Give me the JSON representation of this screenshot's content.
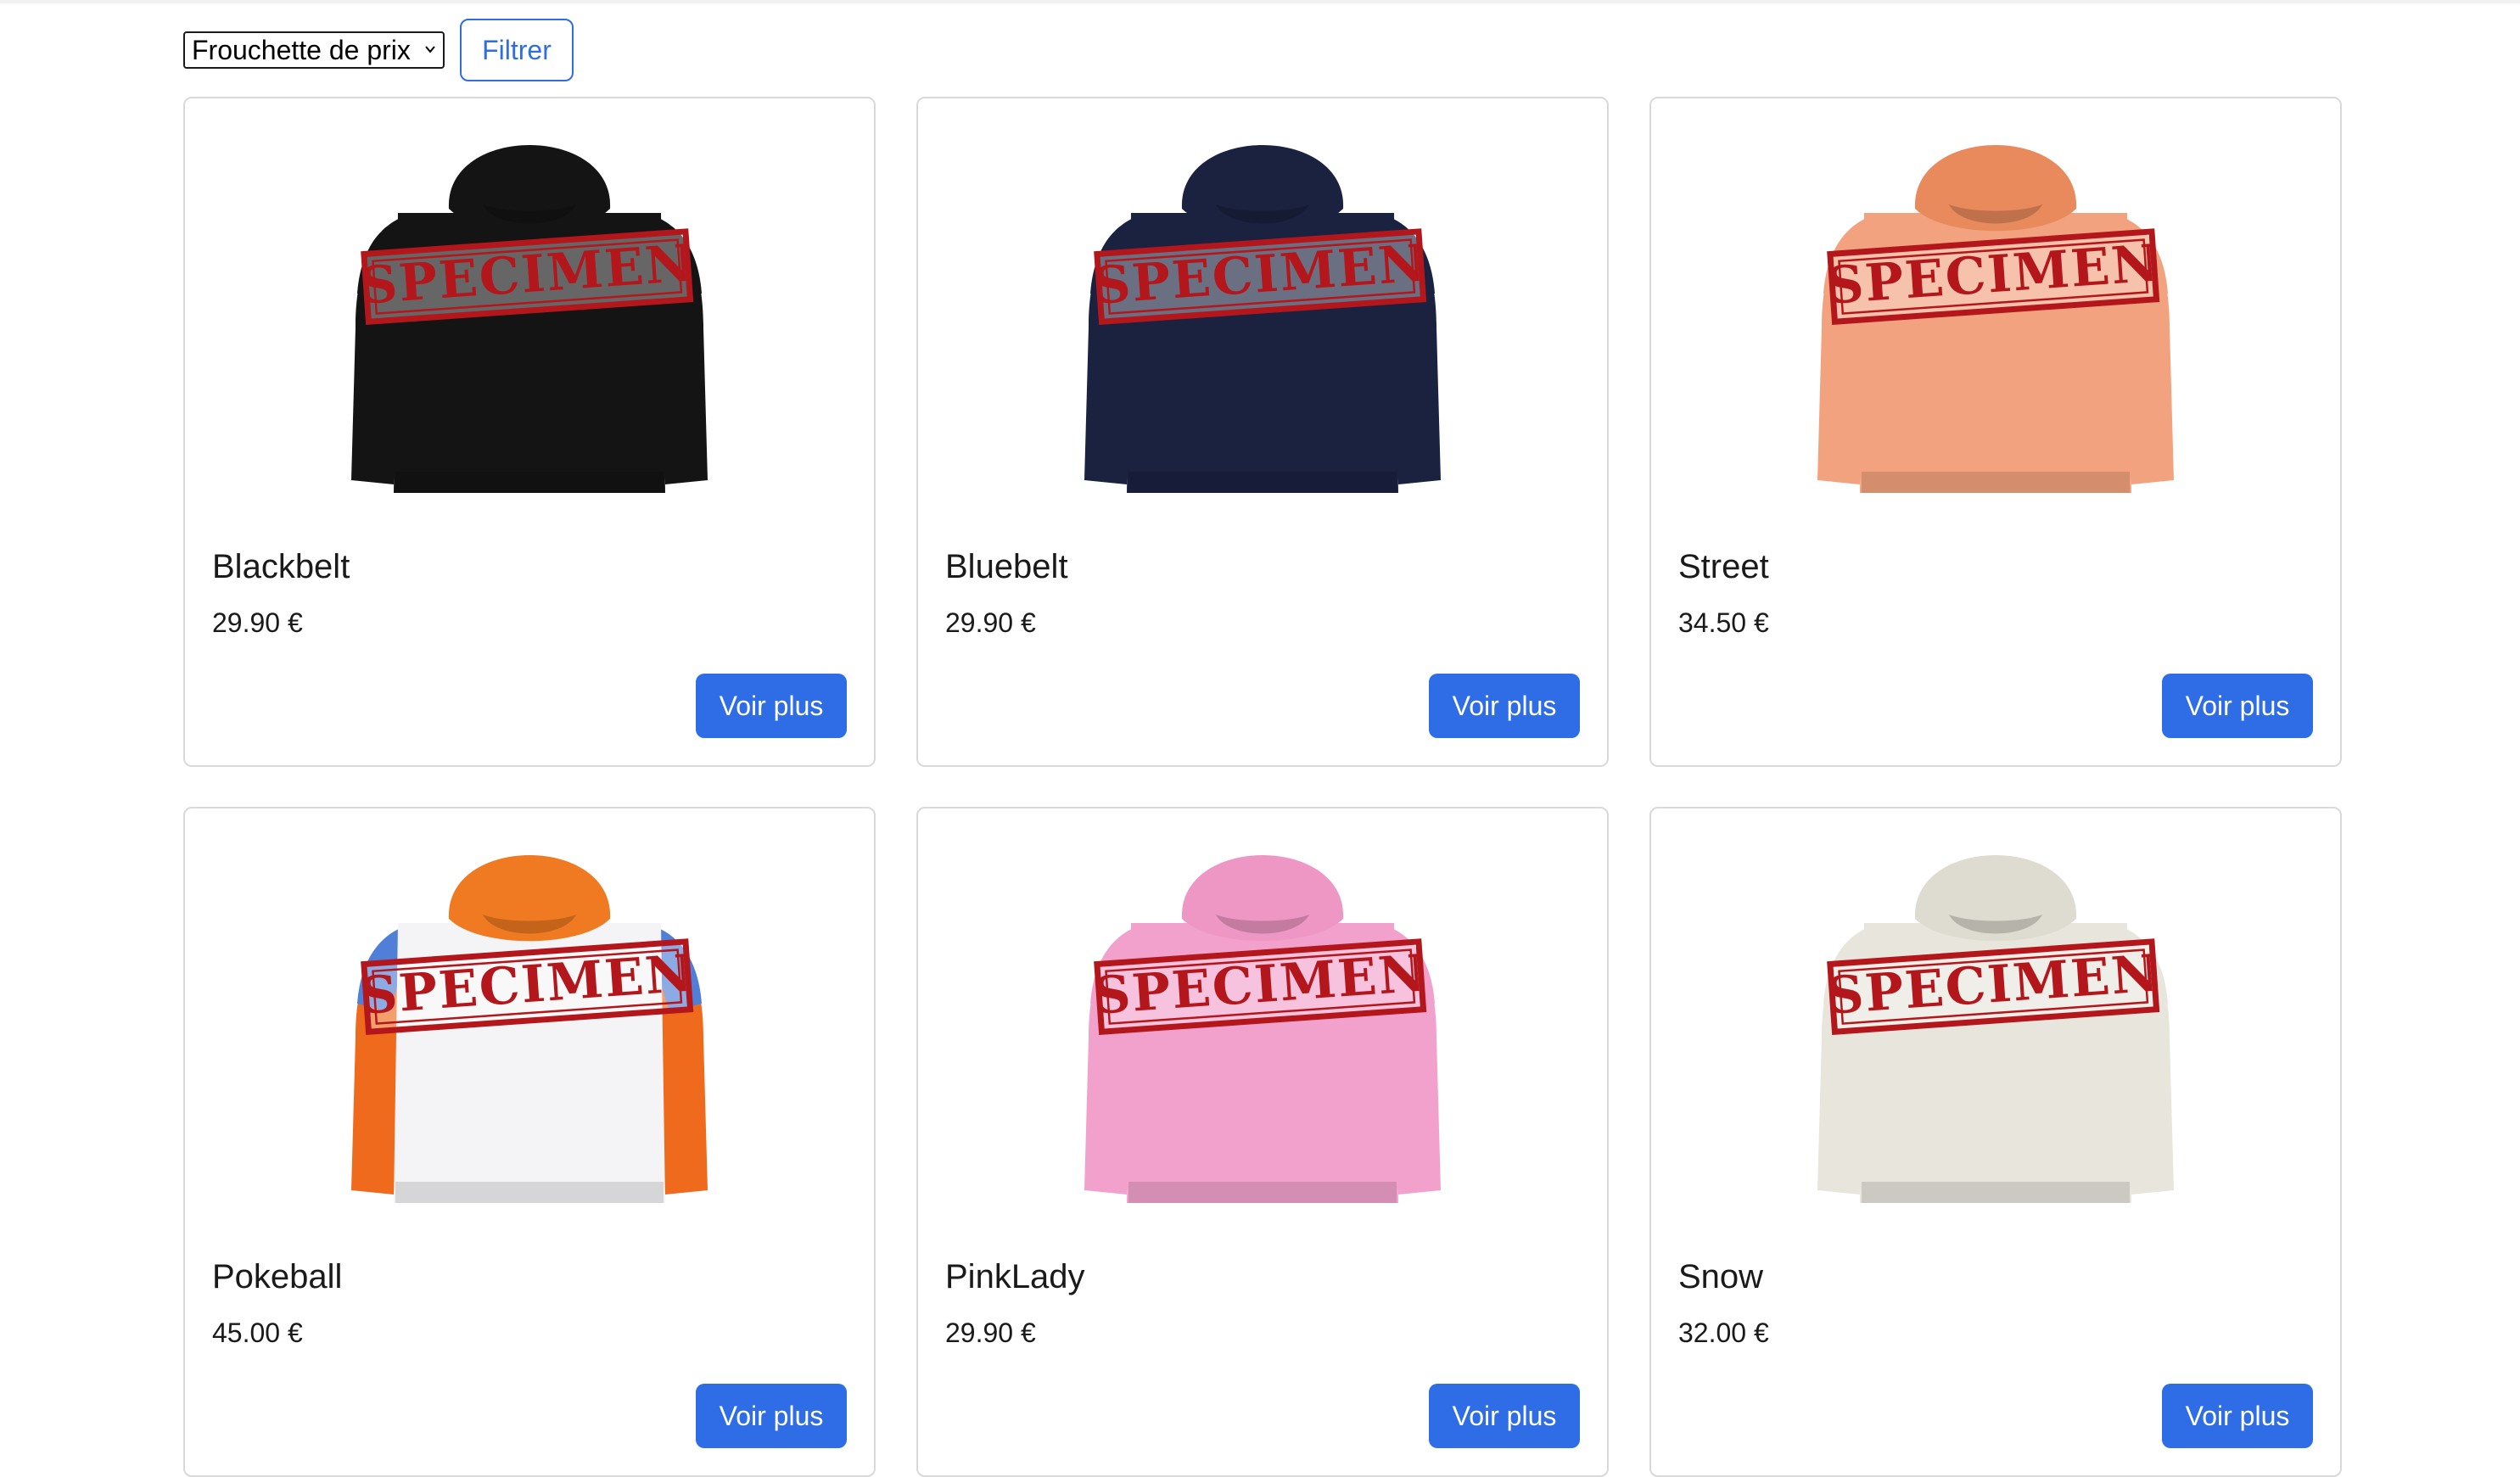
{
  "filters": {
    "price_range_select": "Frouchette de prix",
    "filter_button": "Filtrer"
  },
  "watermark_text": "SPECIMEN",
  "products": [
    {
      "name": "Blackbelt",
      "price": "29.90 €",
      "button": "Voir plus",
      "body_color": "#141414",
      "accent_color": "#141414",
      "hood_color": "#141414"
    },
    {
      "name": "Bluebelt",
      "price": "29.90 €",
      "button": "Voir plus",
      "body_color": "#1b2240",
      "accent_color": "#1b2240",
      "hood_color": "#1b2240"
    },
    {
      "name": "Street",
      "price": "34.50 €",
      "button": "Voir plus",
      "body_color": "#f2a27e",
      "accent_color": "#f2a27e",
      "hood_color": "#e98a5d"
    },
    {
      "name": "Pokeball",
      "price": "45.00 €",
      "button": "Voir plus",
      "body_color": "#f4f4f6",
      "accent_color": "#ef6a1c",
      "hood_color": "#f07a21",
      "shoulder_color": "#4f7fd6"
    },
    {
      "name": "PinkLady",
      "price": "29.90 €",
      "button": "Voir plus",
      "body_color": "#f2a1cc",
      "accent_color": "#f2a1cc",
      "hood_color": "#ef97c4"
    },
    {
      "name": "Snow",
      "price": "32.00 €",
      "button": "Voir plus",
      "body_color": "#e7e5dc",
      "accent_color": "#e7e5dc",
      "hood_color": "#dedbd1"
    }
  ],
  "colors": {
    "primary": "#2f6de6",
    "stamp_red": "#b3171c",
    "card_border": "#d9d9d9"
  }
}
